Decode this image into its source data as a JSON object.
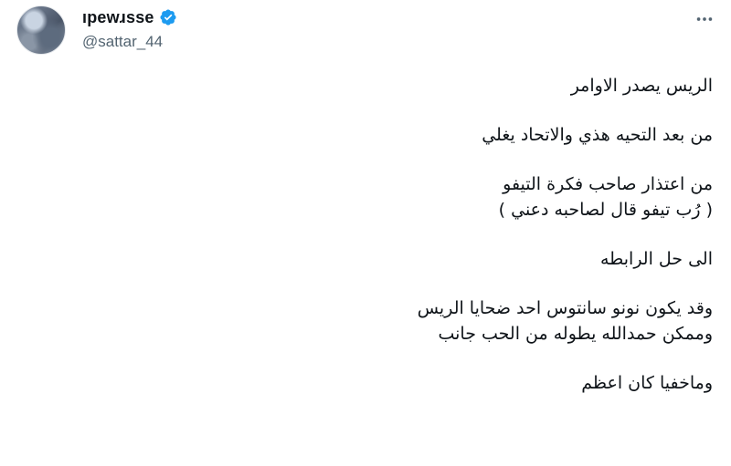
{
  "author": {
    "display_name": "ıpewɹsse",
    "handle": "@sattar_44",
    "verified": true,
    "verified_color": "#1d9bf0"
  },
  "icons": {
    "avatar": "profile-photo",
    "verified": "verified-badge-icon",
    "more": "more-horizontal-icon"
  },
  "tweet": {
    "paragraphs": [
      {
        "lines": [
          "الريس يصدر الاوامر"
        ]
      },
      {
        "lines": [
          "من بعد التحيه هذي والاتحاد يغلي"
        ]
      },
      {
        "lines": [
          "من اعتذار صاحب فكرة التيفو",
          "( رُب تيفو قال لصاحبه دعني )"
        ]
      },
      {
        "lines": [
          "الى حل الرابطه"
        ]
      },
      {
        "lines": [
          "وقد يكون نونو سانتوس احد ضحايا الريس",
          "وممكن حمدالله يطوله من الحب جانب"
        ]
      },
      {
        "lines": [
          "وماخفيا كان اعظم"
        ]
      }
    ]
  }
}
